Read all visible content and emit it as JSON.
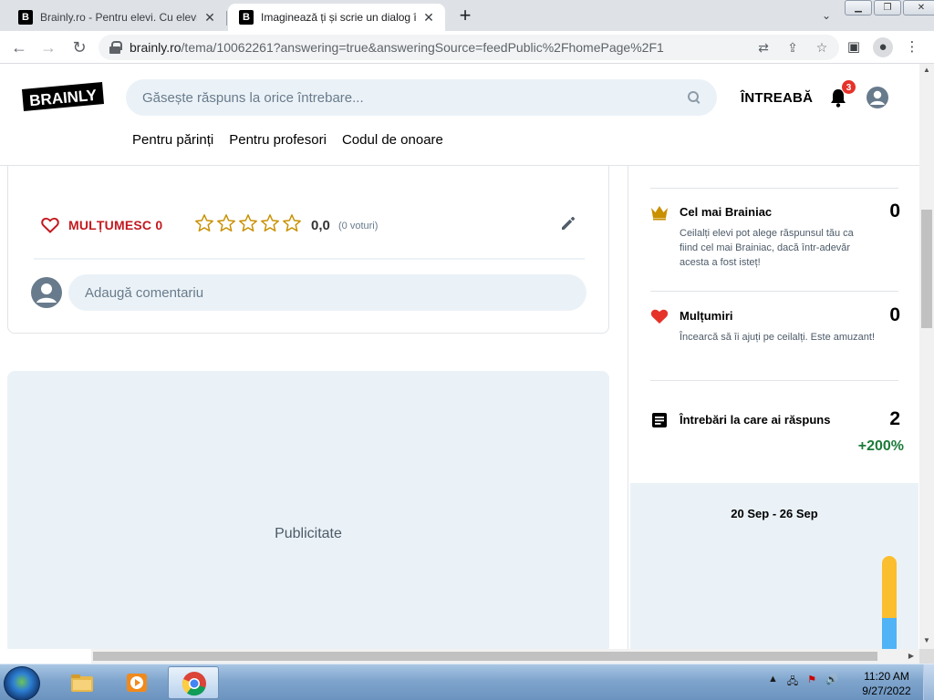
{
  "browser": {
    "tabs": [
      {
        "title": "Brainly.ro - Pentru elevi. Cu elevi.",
        "favicon": "B"
      },
      {
        "title": "Imaginează ți și scrie un dialog în",
        "favicon": "B"
      }
    ],
    "url_host": "brainly.ro",
    "url_path": "/tema/10062261?answering=true&answeringSource=feedPublic%2FhomePage%2F1"
  },
  "header": {
    "logo_text": "BRAINLY",
    "search_placeholder": "Găsește răspuns la orice întrebare...",
    "ask_label": "ÎNTREABĂ",
    "notification_count": "3",
    "nav": [
      "Pentru părinți",
      "Pentru profesori",
      "Codul de onoare"
    ]
  },
  "answer_card": {
    "thanks_label": "MULȚUMESC 0",
    "rating_value": "0,0",
    "votes_label": "(0 voturi)",
    "stars_filled": 0,
    "stars_total": 5,
    "comment_placeholder": "Adaugă comentariu"
  },
  "ad": {
    "label": "Publicitate"
  },
  "stats": {
    "brainiac": {
      "title": "Cel mai Brainiac",
      "value": "0",
      "desc": "Ceilalți elevi pot alege răspunsul tău ca fiind cel mai Brainiac, dacă într-adevăr acesta a fost isteț!"
    },
    "thanks": {
      "title": "Mulțumiri",
      "value": "0",
      "desc": "Încearcă să îi ajuți pe ceilalți. Este amuzant!"
    },
    "answered": {
      "title": "Întrebări la care ai răspuns",
      "value": "2",
      "change": "+200%"
    },
    "week_range": "20 Sep - 26 Sep"
  },
  "colors": {
    "accent_red": "#c3191f",
    "search_bg": "#ebf2f7",
    "crown": "#c99000",
    "growth_green": "#1c7b3a",
    "bar_yellow": "#fbbe2e",
    "bar_blue": "#4fb3f6"
  },
  "taskbar": {
    "time": "11:20 AM",
    "date": "9/27/2022"
  }
}
